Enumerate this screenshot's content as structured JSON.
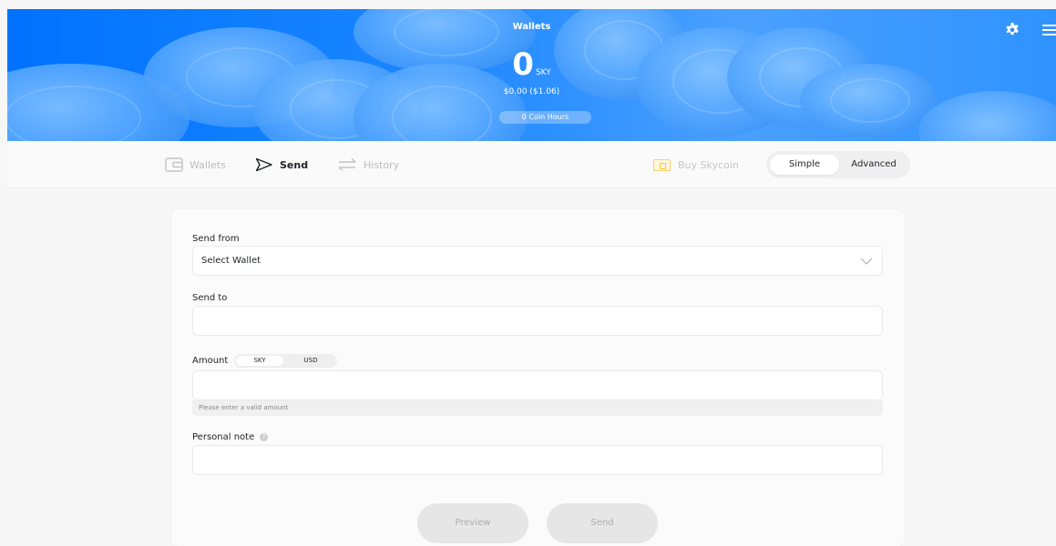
{
  "header": {
    "title": "Wallets",
    "balance": "0",
    "unit": "SKY",
    "usd": "$0.00 ($1.06)",
    "coin_hours": "0 Coin Hours"
  },
  "nav": {
    "wallets": "Wallets",
    "send": "Send",
    "history": "History",
    "buy": "Buy Skycoin",
    "mode_simple": "Simple",
    "mode_advanced": "Advanced"
  },
  "form": {
    "send_from_label": "Send from",
    "send_from_value": "Select Wallet",
    "send_to_label": "Send to",
    "amount_label": "Amount",
    "currency_sky": "SKY",
    "currency_usd": "USD",
    "amount_error": "Please enter a valid amount",
    "note_label": "Personal note",
    "note_help": "?",
    "preview_button": "Preview",
    "send_button": "Send"
  },
  "colors": {
    "header_blue": "#0072ff",
    "accent_yellow": "#ffc13d",
    "button_disabled": "#e6e6e6"
  },
  "icons": [
    "gear-icon",
    "hamburger-menu-icon",
    "wallet-icon",
    "send-arrow-icon",
    "history-arrows-icon",
    "buy-card-icon",
    "chevron-down-icon",
    "help-icon"
  ]
}
